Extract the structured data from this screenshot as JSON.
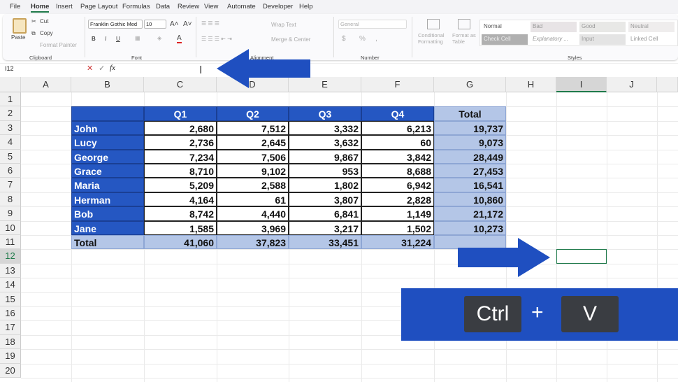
{
  "menu": [
    "File",
    "Home",
    "Insert",
    "Page Layout",
    "Formulas",
    "Data",
    "Review",
    "View",
    "Automate",
    "Developer",
    "Help"
  ],
  "ribbon": {
    "clipboard": {
      "paste": "Paste",
      "cut": "Cut",
      "copy": "Copy",
      "format_painter": "Format Painter",
      "label": "Clipboard"
    },
    "font": {
      "name": "Franklin Gothic Med",
      "size": "10",
      "bold": "B",
      "italic": "I",
      "underline": "U",
      "label": "Font"
    },
    "alignment": {
      "wrap": "Wrap Text",
      "merge": "Merge & Center",
      "label": "Alignment"
    },
    "number": {
      "format": "General",
      "currency": "$",
      "percent": "%",
      "comma": ",",
      "label": "Number"
    },
    "cond": {
      "line1": "Conditional",
      "line2": "Formatting"
    },
    "fmt_table": {
      "line1": "Format as",
      "line2": "Table"
    },
    "styles": {
      "items": [
        "Normal",
        "Bad",
        "Good",
        "Neutral",
        "Check Cell",
        "Explanatory ...",
        "Input",
        "Linked Cell"
      ],
      "label": "Styles"
    }
  },
  "formula_bar": {
    "name_box": "I12",
    "fx": "fx",
    "value": ""
  },
  "columns": [
    "A",
    "B",
    "C",
    "D",
    "E",
    "F",
    "G",
    "H",
    "I",
    "J"
  ],
  "rows": [
    "1",
    "2",
    "3",
    "4",
    "5",
    "6",
    "7",
    "8",
    "9",
    "10",
    "11",
    "12",
    "13",
    "14",
    "15",
    "16",
    "17",
    "18",
    "19",
    "20"
  ],
  "table": {
    "headers": [
      "",
      "Q1",
      "Q2",
      "Q3",
      "Q4",
      "Total"
    ],
    "rows": [
      [
        "John",
        "2,680",
        "7,512",
        "3,332",
        "6,213",
        "19,737"
      ],
      [
        "Lucy",
        "2,736",
        "2,645",
        "3,632",
        "60",
        "9,073"
      ],
      [
        "George",
        "7,234",
        "7,506",
        "9,867",
        "3,842",
        "28,449"
      ],
      [
        "Grace",
        "8,710",
        "9,102",
        "953",
        "8,688",
        "27,453"
      ],
      [
        "Maria",
        "5,209",
        "2,588",
        "1,802",
        "6,942",
        "16,541"
      ],
      [
        "Herman",
        "4,164",
        "61",
        "3,807",
        "2,828",
        "10,860"
      ],
      [
        "Bob",
        "8,742",
        "4,440",
        "6,841",
        "1,149",
        "21,172"
      ],
      [
        "Jane",
        "1,585",
        "3,969",
        "3,217",
        "1,502",
        "10,273"
      ]
    ],
    "total_row": [
      "Total",
      "41,060",
      "37,823",
      "33,451",
      "31,224",
      ""
    ]
  },
  "selected_cell": "I12",
  "shortcut": {
    "key1": "Ctrl",
    "plus": "+",
    "key2": "V"
  },
  "colors": {
    "table_blue": "#2557c2",
    "light_blue": "#b4c6e7",
    "arrow": "#1f4fc0"
  }
}
